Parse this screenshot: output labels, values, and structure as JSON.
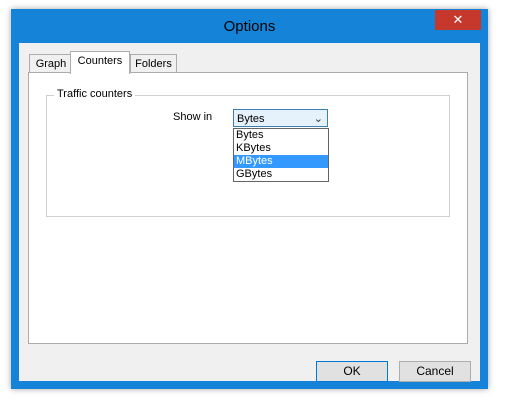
{
  "window": {
    "title": "Options",
    "close_glyph": "✕"
  },
  "tabs": [
    {
      "label": "Graph",
      "active": false
    },
    {
      "label": "Counters",
      "active": true
    },
    {
      "label": "Folders",
      "active": false
    }
  ],
  "counters": {
    "group_label": "Traffic counters",
    "show_in_label": "Show in",
    "selected_value": "Bytes",
    "options": [
      "Bytes",
      "KBytes",
      "MBytes",
      "GBytes"
    ],
    "highlighted_option": "MBytes"
  },
  "buttons": {
    "ok": "OK",
    "cancel": "Cancel"
  },
  "colors": {
    "titlebar": "#1583d7",
    "close": "#c7382c",
    "highlight": "#3399ff"
  }
}
